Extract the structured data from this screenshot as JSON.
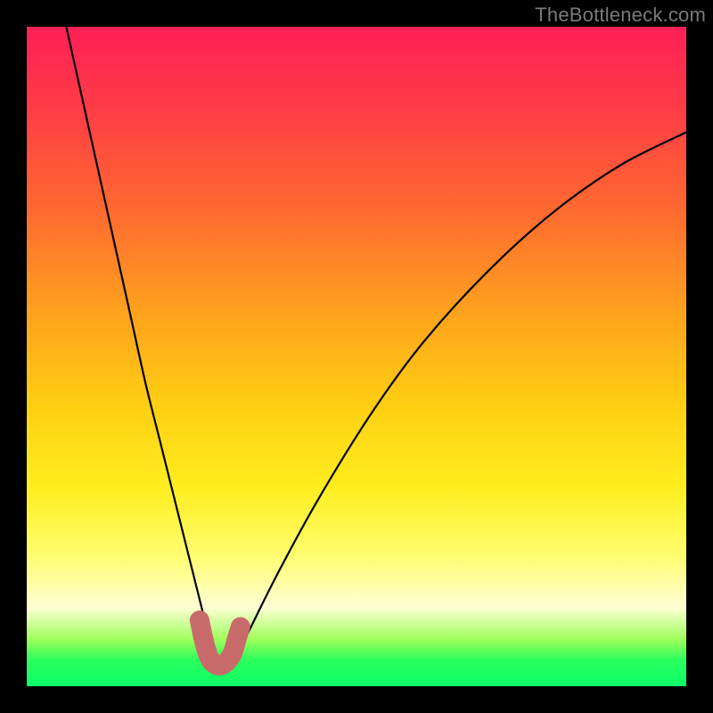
{
  "watermark": "TheBottleneck.com",
  "chart_data": {
    "type": "line",
    "title": "",
    "xlabel": "",
    "ylabel": "",
    "xlim": [
      0,
      100
    ],
    "ylim": [
      0,
      100
    ],
    "series": [
      {
        "name": "bottleneck-curve",
        "x": [
          6,
          8,
          10,
          12,
          14,
          16,
          18,
          20,
          22,
          24,
          26,
          27,
          28,
          29,
          30,
          31,
          32,
          34,
          38,
          44,
          52,
          60,
          70,
          80,
          90,
          100
        ],
        "values": [
          100,
          91,
          82,
          73,
          64,
          55,
          46,
          38,
          30,
          22,
          14,
          10,
          6,
          4,
          3,
          3.5,
          5,
          9,
          17,
          28,
          41,
          52,
          63,
          72,
          79,
          84
        ]
      },
      {
        "name": "highlight-u",
        "x": [
          26.2,
          26.8,
          27.4,
          28.0,
          28.8,
          29.6,
          30.4,
          31.2,
          31.8,
          32.4
        ],
        "values": [
          10.0,
          7.2,
          5.0,
          3.8,
          3.2,
          3.2,
          3.8,
          5.0,
          7.0,
          9.0
        ]
      }
    ],
    "colors": {
      "curve": "#000000",
      "highlight": "#c96a6a"
    }
  }
}
